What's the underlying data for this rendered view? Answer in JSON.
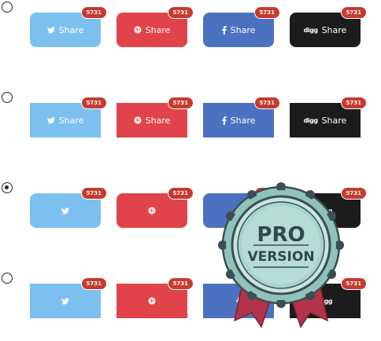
{
  "options": [
    {
      "selected": false,
      "shape": "rounded",
      "show_labels": true,
      "buttons": [
        {
          "network": "twitter",
          "icon": "twitter-bird-icon",
          "label": "Share",
          "count": "5731",
          "color": "#7cc0f0"
        },
        {
          "network": "pinterest",
          "icon": "pinterest-icon",
          "label": "Share",
          "count": "5731",
          "color": "#e0444a"
        },
        {
          "network": "facebook",
          "icon": "facebook-f-icon",
          "label": "Share",
          "count": "5731",
          "color": "#4b72c0"
        },
        {
          "network": "digg",
          "icon": "digg-logo-icon",
          "label": "Share",
          "count": "5731",
          "color": "#1c1c1c"
        }
      ]
    },
    {
      "selected": false,
      "shape": "square",
      "show_labels": true,
      "buttons": [
        {
          "network": "twitter",
          "icon": "twitter-bird-icon",
          "label": "Share",
          "count": "5731",
          "color": "#7cc0f0"
        },
        {
          "network": "pinterest",
          "icon": "pinterest-icon",
          "label": "Share",
          "count": "5731",
          "color": "#e0444a"
        },
        {
          "network": "facebook",
          "icon": "facebook-f-icon",
          "label": "Share",
          "count": "5731",
          "color": "#4b72c0"
        },
        {
          "network": "digg",
          "icon": "digg-logo-icon",
          "label": "Share",
          "count": "5731",
          "color": "#1c1c1c"
        }
      ]
    },
    {
      "selected": true,
      "shape": "rounded",
      "show_labels": false,
      "buttons": [
        {
          "network": "twitter",
          "icon": "twitter-bird-icon",
          "count": "5731",
          "color": "#7cc0f0"
        },
        {
          "network": "pinterest",
          "icon": "pinterest-icon",
          "count": "5731",
          "color": "#e0444a"
        },
        {
          "network": "facebook",
          "icon": "facebook-f-icon",
          "count": "5731",
          "color": "#4b72c0"
        },
        {
          "network": "digg",
          "icon": "digg-logo-icon",
          "count": "5731",
          "color": "#1c1c1c"
        }
      ]
    },
    {
      "selected": false,
      "shape": "square",
      "show_labels": false,
      "buttons": [
        {
          "network": "twitter",
          "icon": "twitter-bird-icon",
          "count": "5731",
          "color": "#7cc0f0"
        },
        {
          "network": "pinterest",
          "icon": "pinterest-icon",
          "count": "5731",
          "color": "#e0444a"
        },
        {
          "network": "facebook",
          "icon": "facebook-f-icon",
          "count": "5731",
          "color": "#4b72c0"
        },
        {
          "network": "digg",
          "icon": "digg-logo-icon",
          "count": "5731",
          "color": "#1c1c1c"
        }
      ]
    }
  ],
  "digg_logo_text": "digg",
  "pro_seal": {
    "line1": "PRO",
    "line2": "VERSION"
  }
}
